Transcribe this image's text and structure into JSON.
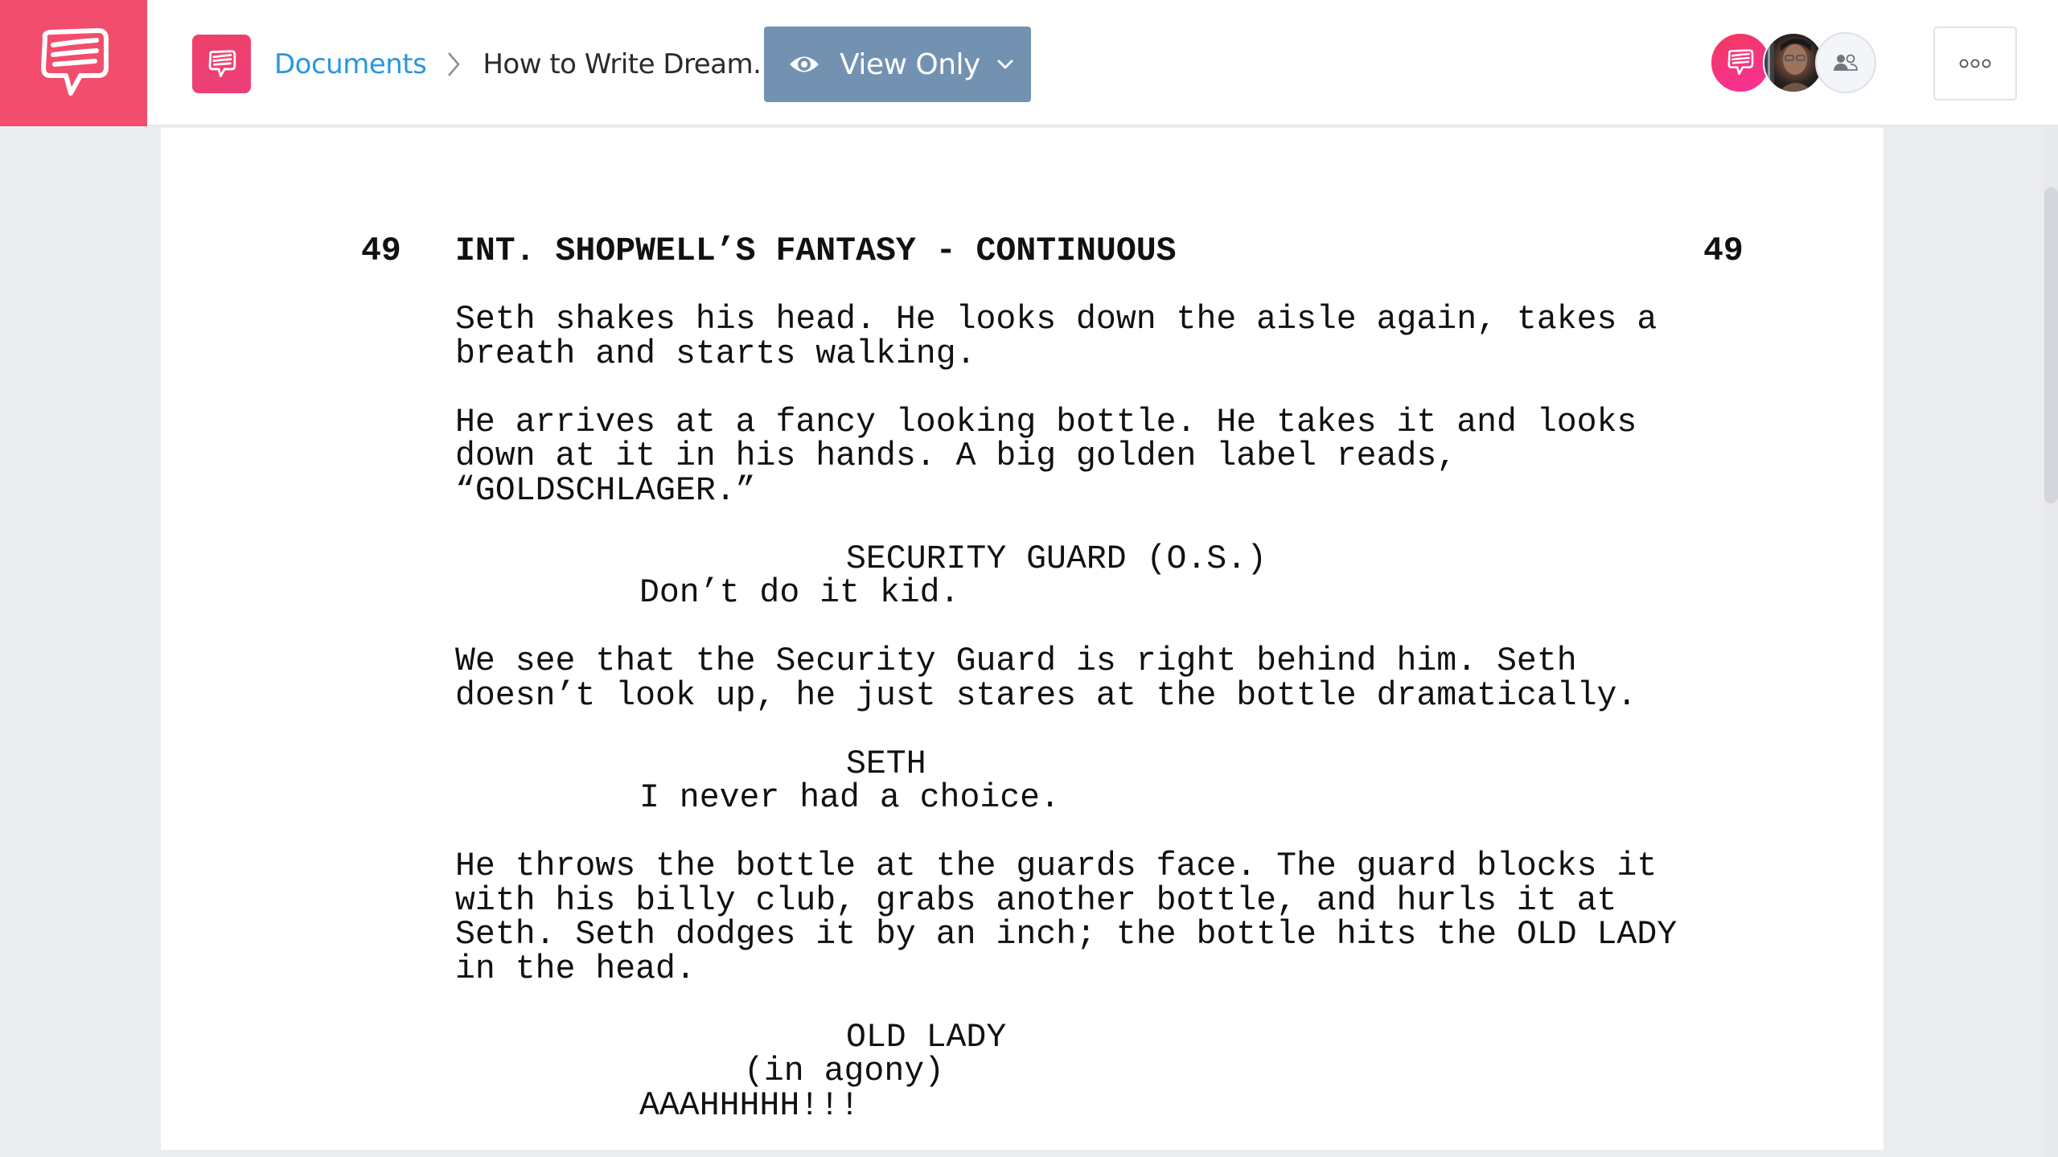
{
  "app": {
    "brand_icon": "chat-bubble-logo-icon",
    "brand_color": "#f24d6c"
  },
  "header": {
    "doc_type_icon": "chat-bubble-icon",
    "breadcrumb": {
      "root": "Documents",
      "separator_icon": "chevron-right-icon",
      "current": "How to Write Dream.."
    },
    "view_mode": {
      "icon": "eye-icon",
      "label": "View Only",
      "dropdown_icon": "chevron-down-icon",
      "color": "#7392b2"
    },
    "collaborators": [
      {
        "type": "brand",
        "icon": "chat-bubble-icon"
      },
      {
        "type": "photo",
        "label": "user-avatar"
      },
      {
        "type": "share",
        "icon": "users-icon"
      }
    ],
    "more_icon": "more-horizontal-icon"
  },
  "script": {
    "scene_number_left": "49",
    "scene_heading": "INT. SHOPWELL’S FANTASY - CONTINUOUS",
    "scene_number_right": "49",
    "blocks": [
      {
        "type": "action",
        "lines": [
          "Seth shakes his head. He looks down the aisle again, takes a",
          "breath and starts walking."
        ]
      },
      {
        "type": "action",
        "lines": [
          "He arrives at a fancy looking bottle. He takes it and looks",
          "down at it in his hands. A big golden label reads,",
          "“GOLDSCHLAGER.”"
        ]
      },
      {
        "type": "character",
        "lines": [
          "SECURITY GUARD (O.S.)"
        ]
      },
      {
        "type": "dialogue",
        "lines": [
          "Don’t do it kid."
        ]
      },
      {
        "type": "action",
        "lines": [
          "We see that the Security Guard is right behind him. Seth",
          "doesn’t look up, he just stares at the bottle dramatically."
        ]
      },
      {
        "type": "character",
        "lines": [
          "SETH"
        ]
      },
      {
        "type": "dialogue",
        "lines": [
          "I never had a choice."
        ]
      },
      {
        "type": "action",
        "lines": [
          "He throws the bottle at the guards face. The guard blocks it",
          "with his billy club, grabs another bottle, and hurls it at",
          "Seth. Seth dodges it by an inch; the bottle hits the OLD LADY",
          "in the head."
        ]
      },
      {
        "type": "character",
        "lines": [
          "OLD LADY"
        ]
      },
      {
        "type": "parenthetical",
        "lines": [
          "(in agony)"
        ]
      },
      {
        "type": "dialogue",
        "lines": [
          "AAAHHHHH!!!"
        ]
      }
    ]
  }
}
